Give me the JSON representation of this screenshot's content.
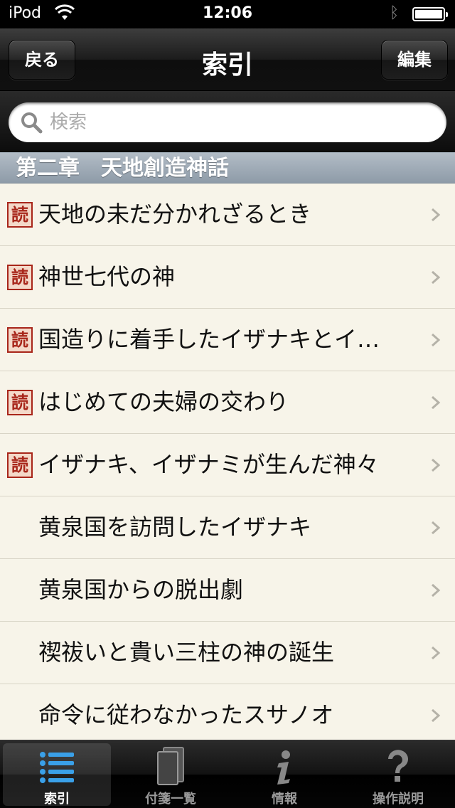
{
  "status": {
    "carrier": "iPod",
    "time": "12:06"
  },
  "nav": {
    "back_label": "戻る",
    "title": "索引",
    "edit_label": "編集"
  },
  "search": {
    "placeholder": "検索"
  },
  "section": {
    "title": "第二章　天地創造神話"
  },
  "badge_text": "読",
  "rows": [
    {
      "label": "天地の未だ分かれざるとき",
      "badge": true
    },
    {
      "label": "神世七代の神",
      "badge": true
    },
    {
      "label": "国造りに着手したイザナキとイ…",
      "badge": true
    },
    {
      "label": "はじめての夫婦の交わり",
      "badge": true
    },
    {
      "label": "イザナキ、イザナミが生んだ神々",
      "badge": true
    },
    {
      "label": "黄泉国を訪問したイザナキ",
      "badge": false
    },
    {
      "label": "黄泉国からの脱出劇",
      "badge": false
    },
    {
      "label": "禊祓いと貴い三柱の神の誕生",
      "badge": false
    },
    {
      "label": "命令に従わなかったスサノオ",
      "badge": false
    }
  ],
  "tabs": [
    {
      "label": "索引",
      "icon": "list-icon",
      "active": true
    },
    {
      "label": "付箋一覧",
      "icon": "pages-icon",
      "active": false
    },
    {
      "label": "情報",
      "icon": "info-icon",
      "active": false
    },
    {
      "label": "操作説明",
      "icon": "help-icon",
      "active": false
    }
  ],
  "colors": {
    "list_bg": "#f7f4e9",
    "badge_red": "#a8261a",
    "section_bg": "#9aa6b2"
  }
}
